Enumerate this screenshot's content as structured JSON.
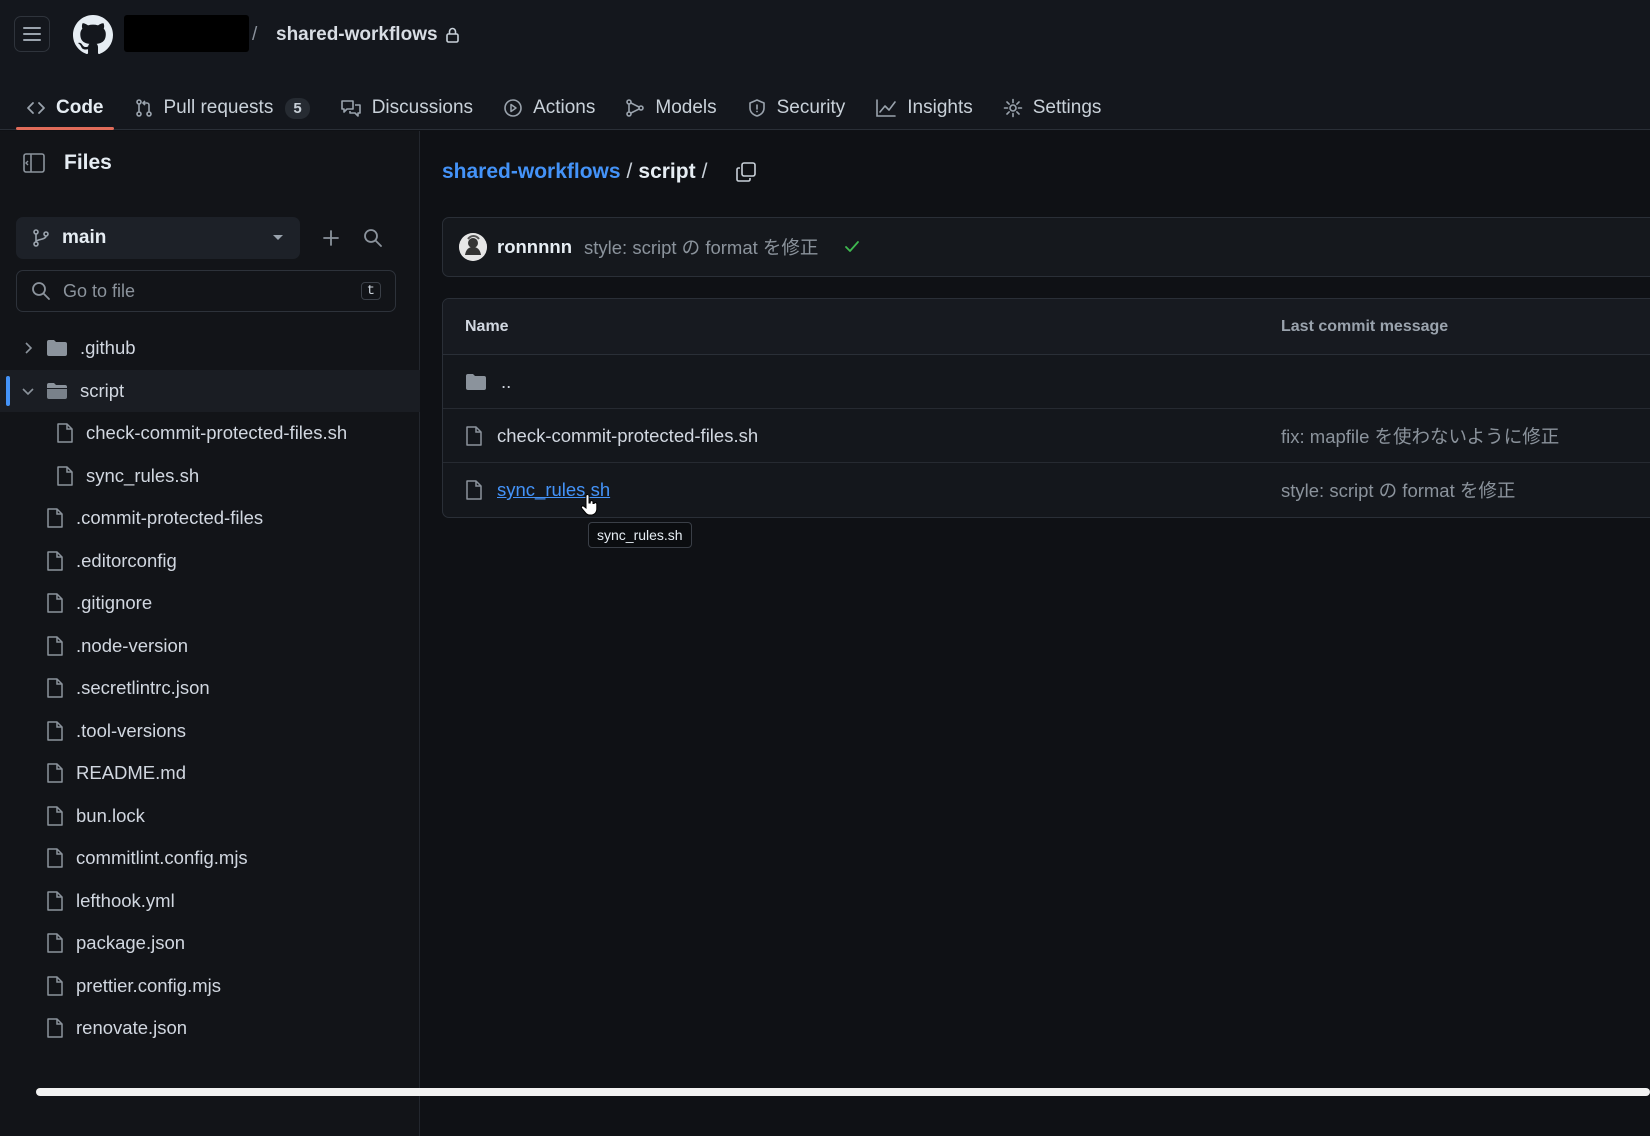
{
  "header": {
    "slash": "/",
    "repo_name": "shared-workflows"
  },
  "tabs": [
    {
      "label": "Code",
      "icon": "code-icon"
    },
    {
      "label": "Pull requests",
      "icon": "git-pull-request-icon",
      "counter": "5"
    },
    {
      "label": "Discussions",
      "icon": "comment-discussion-icon"
    },
    {
      "label": "Actions",
      "icon": "play-icon"
    },
    {
      "label": "Models",
      "icon": "models-icon"
    },
    {
      "label": "Security",
      "icon": "shield-icon"
    },
    {
      "label": "Insights",
      "icon": "graph-icon"
    },
    {
      "label": "Settings",
      "icon": "gear-icon"
    }
  ],
  "sidebar": {
    "title": "Files",
    "branch": "main",
    "goto_placeholder": "Go to file",
    "goto_shortcut": "t",
    "tree": [
      {
        "label": ".github"
      },
      {
        "label": "script"
      },
      {
        "label": "check-commit-protected-files.sh"
      },
      {
        "label": "sync_rules.sh"
      },
      {
        "label": ".commit-protected-files"
      },
      {
        "label": ".editorconfig"
      },
      {
        "label": ".gitignore"
      },
      {
        "label": ".node-version"
      },
      {
        "label": ".secretlintrc.json"
      },
      {
        "label": ".tool-versions"
      },
      {
        "label": "README.md"
      },
      {
        "label": "bun.lock"
      },
      {
        "label": "commitlint.config.mjs"
      },
      {
        "label": "lefthook.yml"
      },
      {
        "label": "package.json"
      },
      {
        "label": "prettier.config.mjs"
      },
      {
        "label": "renovate.json"
      }
    ]
  },
  "breadcrumb": {
    "repo": "shared-workflows",
    "sep1": "/",
    "dir": "script",
    "sep2": "/"
  },
  "latest_commit": {
    "user": "ronnnnn",
    "message": "style: script の format を修正"
  },
  "file_table": {
    "col_name": "Name",
    "col_msg": "Last commit message",
    "rows": [
      {
        "name": "..",
        "message": ""
      },
      {
        "name": "check-commit-protected-files.sh",
        "message": "fix: mapfile を使わないように修正"
      },
      {
        "name": "sync_rules.sh",
        "message": "style: script の format を修正"
      }
    ]
  },
  "tooltip": "sync_rules.sh",
  "colors": {
    "accent_link": "#4493f8",
    "active_tab_underline": "#e06c5a",
    "success": "#3fb950"
  }
}
